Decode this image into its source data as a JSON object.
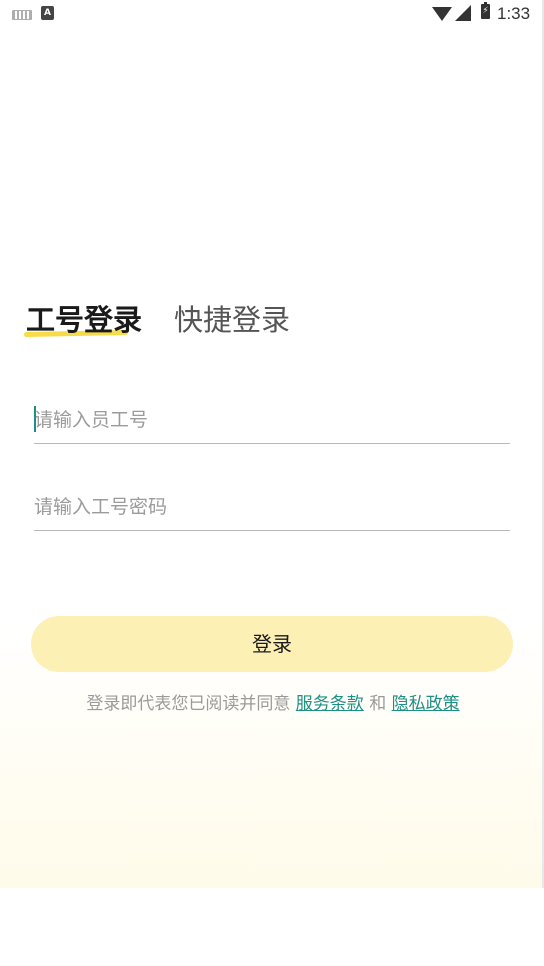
{
  "status_bar": {
    "a_badge": "A",
    "time": "1:33",
    "icons": [
      "keyboard-icon",
      "a-badge-icon",
      "wifi-icon",
      "signal-icon",
      "battery-charging-icon"
    ]
  },
  "tabs": {
    "active": "工号登录",
    "inactive": "快捷登录"
  },
  "form": {
    "employee_id_placeholder": "请输入员工号",
    "employee_id_value": "",
    "password_placeholder": "请输入工号密码",
    "password_value": ""
  },
  "login_button": "登录",
  "agreement": {
    "prefix": "登录即代表您已阅读并同意",
    "terms_link": "服务条款",
    "conjunction": "和",
    "privacy_link": "隐私政策"
  },
  "colors": {
    "accent_yellow": "#f7dc4a",
    "button_bg": "#fdf0b4",
    "link": "#1e8f84"
  }
}
